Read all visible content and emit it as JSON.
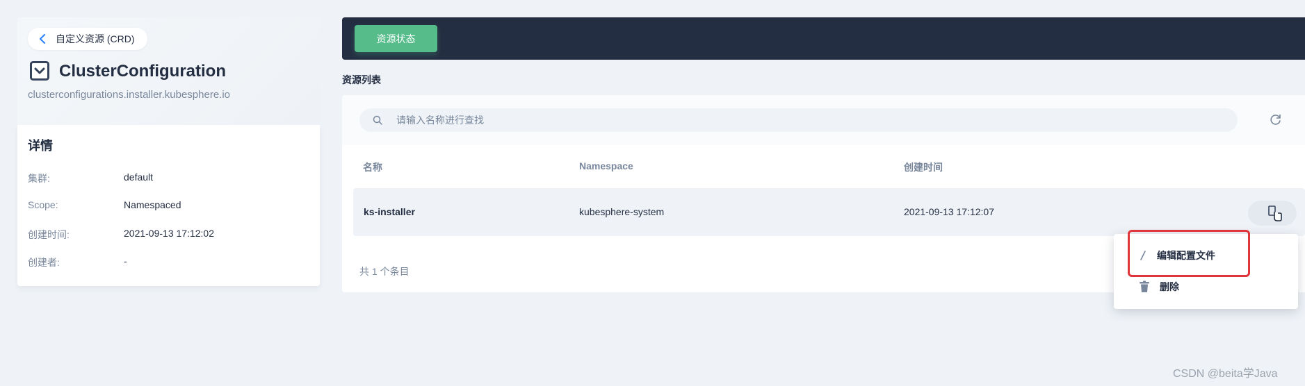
{
  "back_link": {
    "label": "自定义资源 (CRD)"
  },
  "crd": {
    "title": "ClusterConfiguration",
    "subtitle": "clusterconfigurations.installer.kubesphere.io"
  },
  "details": {
    "title": "详情",
    "rows": [
      {
        "label": "集群:",
        "value": "default"
      },
      {
        "label": "Scope:",
        "value": "Namespaced"
      },
      {
        "label": "创建时间:",
        "value": "2021-09-13 17:12:02"
      },
      {
        "label": "创建者:",
        "value": "-"
      }
    ]
  },
  "topbar": {
    "status_button": "资源状态"
  },
  "section": {
    "title": "资源列表"
  },
  "search": {
    "placeholder": "请输入名称进行查找"
  },
  "table": {
    "columns": [
      "名称",
      "Namespace",
      "创建时间"
    ],
    "rows": [
      {
        "name": "ks-installer",
        "namespace": "kubesphere-system",
        "created": "2021-09-13 17:12:07"
      }
    ],
    "footer": "共 1 个条目"
  },
  "menu": {
    "items": [
      {
        "label": "编辑配置文件",
        "icon": "pencil-icon"
      },
      {
        "label": "删除",
        "icon": "trash-icon"
      }
    ]
  },
  "watermark": "CSDN @beita学Java",
  "colors": {
    "accent_green": "#55bc8a",
    "dark_bar": "#242e42",
    "highlight_red": "#e0353a",
    "background": "#eff3f7"
  }
}
